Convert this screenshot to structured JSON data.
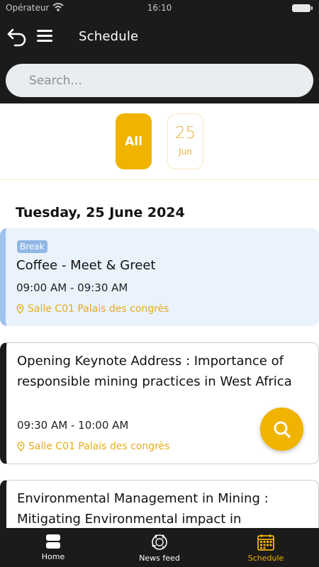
{
  "status_bar": {
    "carrier": "Opérateur",
    "time": "16:10"
  },
  "header": {
    "title": "Schedule"
  },
  "search": {
    "placeholder": "Search..."
  },
  "date_filter": {
    "all_label": "All",
    "dates": [
      {
        "day": "25",
        "month": "Jun"
      }
    ]
  },
  "schedule": {
    "day_heading": "Tuesday, 25 June 2024",
    "items": [
      {
        "badge": "Break",
        "title": "Coffee - Meet & Greet",
        "time": "09:00 AM - 09:30 AM",
        "location": "Salle C01 Palais des congrès"
      },
      {
        "title": "Opening Keynote Address : Importance of responsible mining practices in West Africa",
        "time": "09:30 AM - 10:00 AM",
        "location": "Salle C01 Palais des congrès"
      },
      {
        "title": "Environmental Management in Mining : Mitigating Environmental impact in"
      }
    ]
  },
  "tab_bar": {
    "tabs": [
      {
        "label": "Home",
        "icon": "home-icon"
      },
      {
        "label": "News feed",
        "icon": "news-icon"
      },
      {
        "label": "Schedule",
        "icon": "calendar-icon"
      }
    ],
    "active": "Schedule"
  },
  "colors": {
    "accent": "#f0b400",
    "header_bg": "#1b1b1b",
    "break_card": "#eaf2fc",
    "break_badge": "#8eb7e6"
  }
}
